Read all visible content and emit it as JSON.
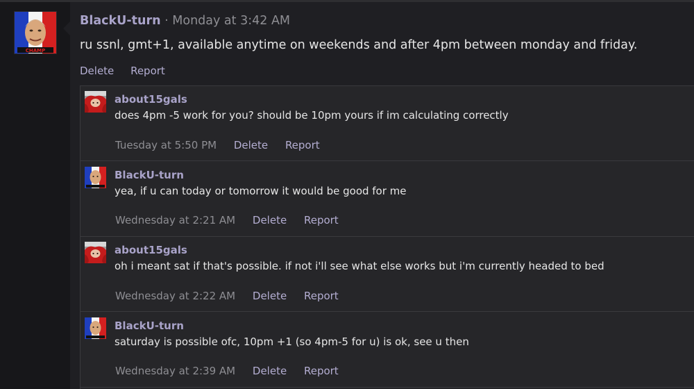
{
  "post": {
    "author": "BlackU-turn",
    "separator": "·",
    "timestamp": "Monday at 3:42 AM",
    "body": "ru ssnl, gmt+1, available anytime on weekends and after 4pm between monday and friday.",
    "actions": {
      "delete": "Delete",
      "report": "Report"
    },
    "avatar_text": "CHAMP"
  },
  "replies": [
    {
      "author": "about15gals",
      "text": "does 4pm -5 work for you? should be 10pm yours if im calculating correctly",
      "timestamp": "Tuesday at 5:50 PM",
      "delete": "Delete",
      "report": "Report"
    },
    {
      "author": "BlackU-turn",
      "text": "yea, if u can today or tomorrow it would be good for me",
      "timestamp": "Wednesday at 2:21 AM",
      "delete": "Delete",
      "report": "Report"
    },
    {
      "author": "about15gals",
      "text": "oh i meant sat if that's possible. if not i'll see what else works but i'm currently headed to bed",
      "timestamp": "Wednesday at 2:22 AM",
      "delete": "Delete",
      "report": "Report"
    },
    {
      "author": "BlackU-turn",
      "text": "saturday is possible ofc, 10pm +1 (so 4pm-5 for u) is ok, see u then",
      "timestamp": "Wednesday at 2:39 AM",
      "delete": "Delete",
      "report": "Report"
    }
  ],
  "colors": {
    "username": "#a9a3c9",
    "action_link": "#b4aed2",
    "timestamp": "#8e8e93",
    "body_text": "#e6e6e6",
    "background": "#1b1b1e"
  }
}
